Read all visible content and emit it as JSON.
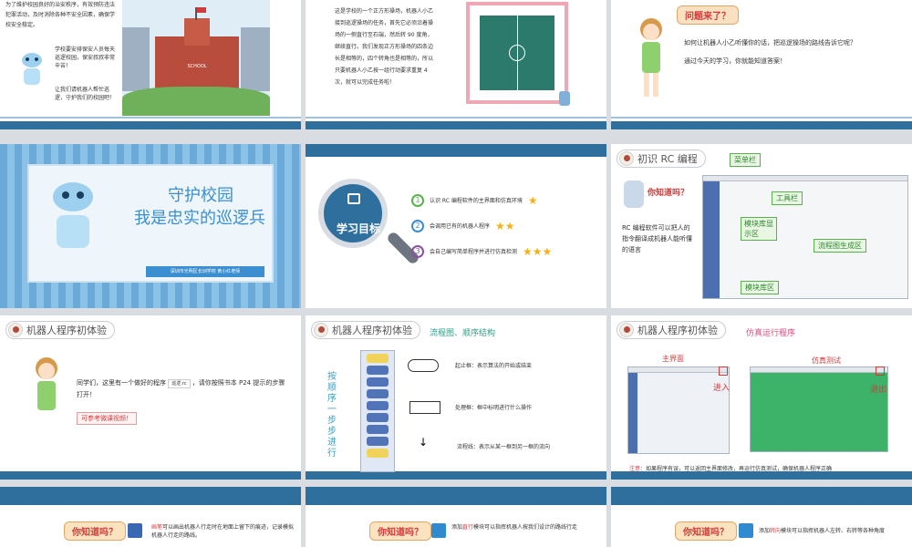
{
  "colors": {
    "brand_blue": "#2f6f9e",
    "light_blue": "#5aa5d9",
    "teal": "#2b7a8f",
    "star": "#f3b21b",
    "red_text": "#d23a3a"
  },
  "slides": {
    "s1": {
      "intro": "为了维护校园良好的治安秩序，有效预防违法犯罪活动，及时消除各种不安全因素，确保学校安全稳定。",
      "p2": "学校要安排保安人员每天巡逻校园，保安叔叔非常辛苦！",
      "p3": "让我们请机器人帮忙巡逻，守护我们的校园吧！",
      "school_sign": "SCHOOL"
    },
    "s2": {
      "text": "这是学校的一个正方形操场，机器人小乙接到巡逻操场的任务，首先它必须沿着操场的一侧直行至石端，然后转 90 度角，继续直行。我们发现正方形操场的四条边长是相等的，四个转角也是相等的，所以只要机器人小乙按一组行动要求重复 4 次，就可以完成任务啦！"
    },
    "s3": {
      "bubble": "问题来了？",
      "q": "如何让机器人小乙听懂你的话，把巡逻操场的路线告诉它呢？",
      "a": "通过今天的学习，你就能知道答案！"
    },
    "s4": {
      "title_line1": "守护校园",
      "title_line2": "我是忠实的巡逻兵",
      "author": "深圳市光明区长圳学校 黄小红老师"
    },
    "s5": {
      "circle_label": "学习目标",
      "items": [
        {
          "num": "1",
          "text": "认识 RC 编程软件的主界面和仿真环境"
        },
        {
          "num": "2",
          "text": "会调用已有的机器人程序"
        },
        {
          "num": "3",
          "text": "会自己编写简单程序并进行仿真检测"
        }
      ],
      "stars": [
        "★",
        "★★",
        "★★★"
      ]
    },
    "s6": {
      "header": "初识 RC 编程",
      "know": "你知道吗？",
      "desc": "RC 编程软件可以把人的指令翻译成机器人能听懂的语言",
      "labels": {
        "menu": "菜单栏",
        "tool": "工具栏",
        "lib": "模块库显示区",
        "flow": "流程图生成区",
        "libarea": "模块库区"
      }
    },
    "s7": {
      "header": "机器人程序初体验",
      "text1": "同学们，这里有一个做好的程序",
      "chip": "巡逻.rc",
      "text2": "，请你按照书本 P24 提示的步骤打开！",
      "note": "可参考微课视频！"
    },
    "s8": {
      "header": "机器人程序初体验",
      "sub": "流程图、顺序结构",
      "side": "按顺序一步步进行",
      "rows": [
        {
          "label": "起止框：表示算法的开始或结束"
        },
        {
          "label": "处理框：框中标明进行什么操作"
        },
        {
          "label": "流程线：表示从某一框到另一框的流向"
        }
      ],
      "arrow": "↓"
    },
    "s9": {
      "header": "机器人程序初体验",
      "sub": "仿真运行程序",
      "main": "主界面",
      "sim": "仿真测试",
      "enter": "进入",
      "exit": "退出",
      "note_label": "注意：",
      "note": "如果程序有误，可以返回主界面修改，再运行仿真测试，确保机器人程序正确"
    },
    "s10": {
      "know": "你知道吗？",
      "kw": "画笔",
      "text": "可以画出机器人行走时在地面上留下的痕迹，记录模拟机器人行走的路线。"
    },
    "s11": {
      "know": "你知道吗？",
      "pre": "添加",
      "kw": "直行",
      "text": "模块可以指挥机器人按我们设计的路线行走"
    },
    "s12": {
      "know": "你知道吗？",
      "pre": "添加",
      "kw": "转向",
      "text": "模块可以指挥机器人左转、右转等各种角度"
    }
  }
}
